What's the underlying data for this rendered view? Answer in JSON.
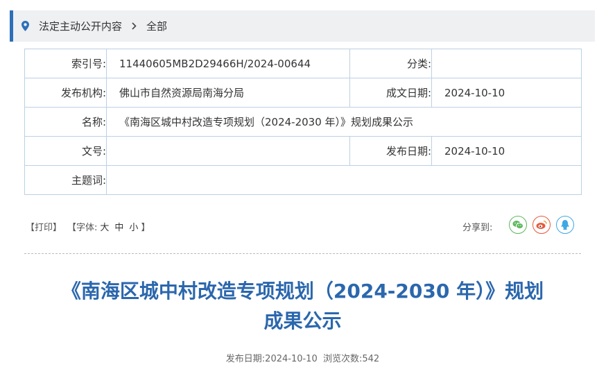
{
  "breadcrumb": {
    "section": "法定主动公开内容",
    "current": "全部"
  },
  "meta": {
    "index_label": "索引号:",
    "index_value": "11440605MB2D29466H/2024-00644",
    "category_label": "分类:",
    "category_value": "",
    "publisher_label": "发布机构:",
    "publisher_value": "佛山市自然资源局南海分局",
    "created_label": "成文日期:",
    "created_value": "2024-10-10",
    "name_label": "名称:",
    "name_value": "《南海区城中村改造专项规划（2024-2030 年）》规划成果公示",
    "docno_label": "文号:",
    "docno_value": "",
    "pubdate_label": "发布日期:",
    "pubdate_value": "2024-10-10",
    "keywords_label": "主题词:",
    "keywords_value": ""
  },
  "toolbar": {
    "print": "【打印】",
    "font_prefix": "【字体:",
    "font_large": "大",
    "font_medium": "中",
    "font_small": "小",
    "font_suffix": "】",
    "share_label": "分享到:"
  },
  "article": {
    "title_line1": "《南海区城中村改造专项规划（2024-2030 年）》规划",
    "title_line2": "成果公示",
    "pub_label": "发布日期:",
    "pub_date": "2024-10-10",
    "views_label": "浏览次数:",
    "views": "542"
  },
  "colors": {
    "accent": "#2e6fb8",
    "title": "#2b67ad",
    "wechat": "#5cb85c",
    "weibo": "#e8593a",
    "qq": "#3fa7e6"
  }
}
